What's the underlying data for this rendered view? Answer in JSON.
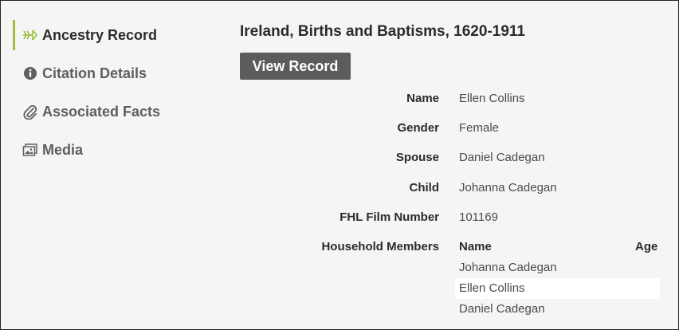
{
  "sidebar": {
    "items": [
      {
        "label": "Ancestry Record",
        "icon": "ancestry-leaf-icon"
      },
      {
        "label": "Citation Details",
        "icon": "info-icon"
      },
      {
        "label": "Associated Facts",
        "icon": "paperclip-icon"
      },
      {
        "label": "Media",
        "icon": "photos-icon"
      }
    ],
    "active_color": "#9bbf3a"
  },
  "record": {
    "title": "Ireland, Births and Baptisms, 1620-1911",
    "view_button_label": "View Record",
    "fields": [
      {
        "label": "Name",
        "value": "Ellen Collins"
      },
      {
        "label": "Gender",
        "value": "Female"
      },
      {
        "label": "Spouse",
        "value": "Daniel Cadegan"
      },
      {
        "label": "Child",
        "value": "Johanna Cadegan"
      },
      {
        "label": "FHL Film Number",
        "value": "101169"
      }
    ],
    "household": {
      "label": "Household Members",
      "columns": [
        "Name",
        "Age"
      ],
      "rows": [
        {
          "name": "Johanna Cadegan"
        },
        {
          "name": "Ellen Collins"
        },
        {
          "name": "Daniel Cadegan"
        }
      ]
    }
  }
}
